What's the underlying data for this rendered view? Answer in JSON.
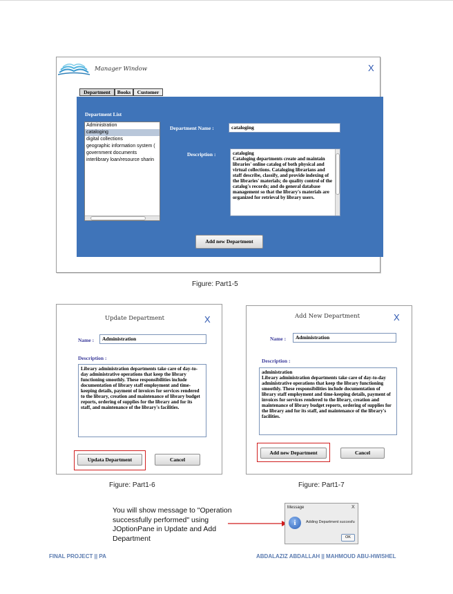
{
  "manager_window": {
    "title": "Manager Window",
    "close": "X",
    "tabs": [
      "Department",
      "Books",
      "Customer"
    ],
    "list_label": "Department List",
    "departments": [
      "Administration",
      "cataloging",
      "digital collections",
      "geographic information system (",
      "government documents",
      "interlibrary loan/resource sharin"
    ],
    "selected_index": 1,
    "name_label": "Department Name :",
    "name_value": "cataloging",
    "description_label": "Description :",
    "description_value": "cataloging\nCataloging departments create and maintain libraries' online catalog of both physical and virtual collections. Cataloging librarians and staff describe, classify, and provide indexing of the libraries' materials; do quality control of the catalog's records; and do general database management so that the library's materials are organized for retrieval by library users.",
    "add_button": "Add new Department"
  },
  "caption_1": "Figure: Part1-5",
  "update_dialog": {
    "title": "Update Department",
    "close": "X",
    "name_label": "Name :",
    "name_value": "Administration",
    "description_label": "Description :",
    "description_value": "Library administration departments take care of day-to-day administrative operations that keep the library functioning smoothly. These responsibilities include documentation of library staff employment and time-keeping details, payment of invoices for services rendered to the library, creation and maintenance of library budget reports, ordering of supplies for the library and for its staff, and maintenance of the library's facilities.",
    "update_button": "Updata Department",
    "cancel_button": "Cancel"
  },
  "caption_2": "Figure: Part1-6",
  "add_dialog": {
    "title": "Add New Department",
    "close": "X",
    "name_label": "Name :",
    "name_value": "Administration",
    "description_label": "Description :",
    "description_value": "administration\nLibrary administration departments take care of day-to-day administrative operations that keep the library functioning smoothly. These responsibilities include documentation of library staff employment and time-keeping details, payment of invoices for services rendered to the library, creation and maintenance of library budget reports, ordering of supplies for the library and for its staff, and maintenance of the library's facilities.",
    "add_button": "Add new Department",
    "cancel_button": "Cancel"
  },
  "caption_3": "Figure: Part1-7",
  "note_text": "You will show message to \"Operation successfully performed\" using JOptionPane in Update and Add Department",
  "message_box": {
    "title": "Message",
    "close": "X",
    "icon": "i",
    "text": "Adding Department succesfu",
    "ok": "OK"
  },
  "footer": {
    "left": "FINAL PROJECT || PA",
    "right": "ABDALAZIZ ABDALLAH || MAHMOUD ABU-HWISHEL"
  },
  "colors": {
    "panel_blue": "#3f74b9",
    "highlight_red": "#d01c1c",
    "footer_blue": "#5b7bb0"
  }
}
